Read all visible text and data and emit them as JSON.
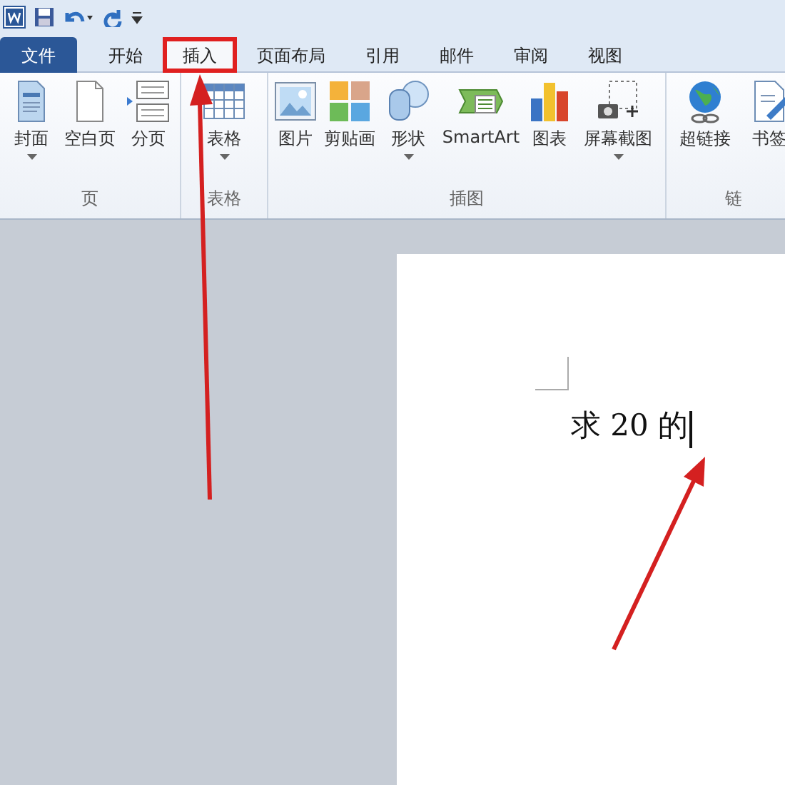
{
  "tabs": [
    {
      "label": "文件",
      "kind": "file",
      "selected": false
    },
    {
      "label": "开始",
      "kind": "tab",
      "selected": false
    },
    {
      "label": "插入",
      "kind": "tab",
      "selected": true
    },
    {
      "label": "页面布局",
      "kind": "tab",
      "selected": false
    },
    {
      "label": "引用",
      "kind": "tab",
      "selected": false
    },
    {
      "label": "邮件",
      "kind": "tab",
      "selected": false
    },
    {
      "label": "审阅",
      "kind": "tab",
      "selected": false
    },
    {
      "label": "视图",
      "kind": "tab",
      "selected": false
    }
  ],
  "ribbon_groups": [
    {
      "label": "页",
      "buttons": [
        {
          "label": "封面",
          "kind": "cover",
          "dropdown": true
        },
        {
          "label": "空白页",
          "kind": "blank",
          "dropdown": false
        },
        {
          "label": "分页",
          "kind": "break",
          "dropdown": false
        }
      ]
    },
    {
      "label": "表格",
      "buttons": [
        {
          "label": "表格",
          "kind": "table",
          "dropdown": true
        }
      ]
    },
    {
      "label": "插图",
      "buttons": [
        {
          "label": "图片",
          "kind": "picture",
          "dropdown": false
        },
        {
          "label": "剪贴画",
          "kind": "clipart",
          "dropdown": false
        },
        {
          "label": "形状",
          "kind": "shapes",
          "dropdown": true
        },
        {
          "label": "SmartArt",
          "kind": "smartart",
          "dropdown": false
        },
        {
          "label": "图表",
          "kind": "chart",
          "dropdown": false
        },
        {
          "label": "屏幕截图",
          "kind": "screenshot",
          "dropdown": true
        }
      ]
    },
    {
      "label": "链",
      "buttons": [
        {
          "label": "超链接",
          "kind": "hyperlink",
          "dropdown": false
        },
        {
          "label": "书签",
          "kind": "bookmark",
          "dropdown": false
        }
      ]
    }
  ],
  "document": {
    "text": "求 20 的",
    "cursor": true
  }
}
